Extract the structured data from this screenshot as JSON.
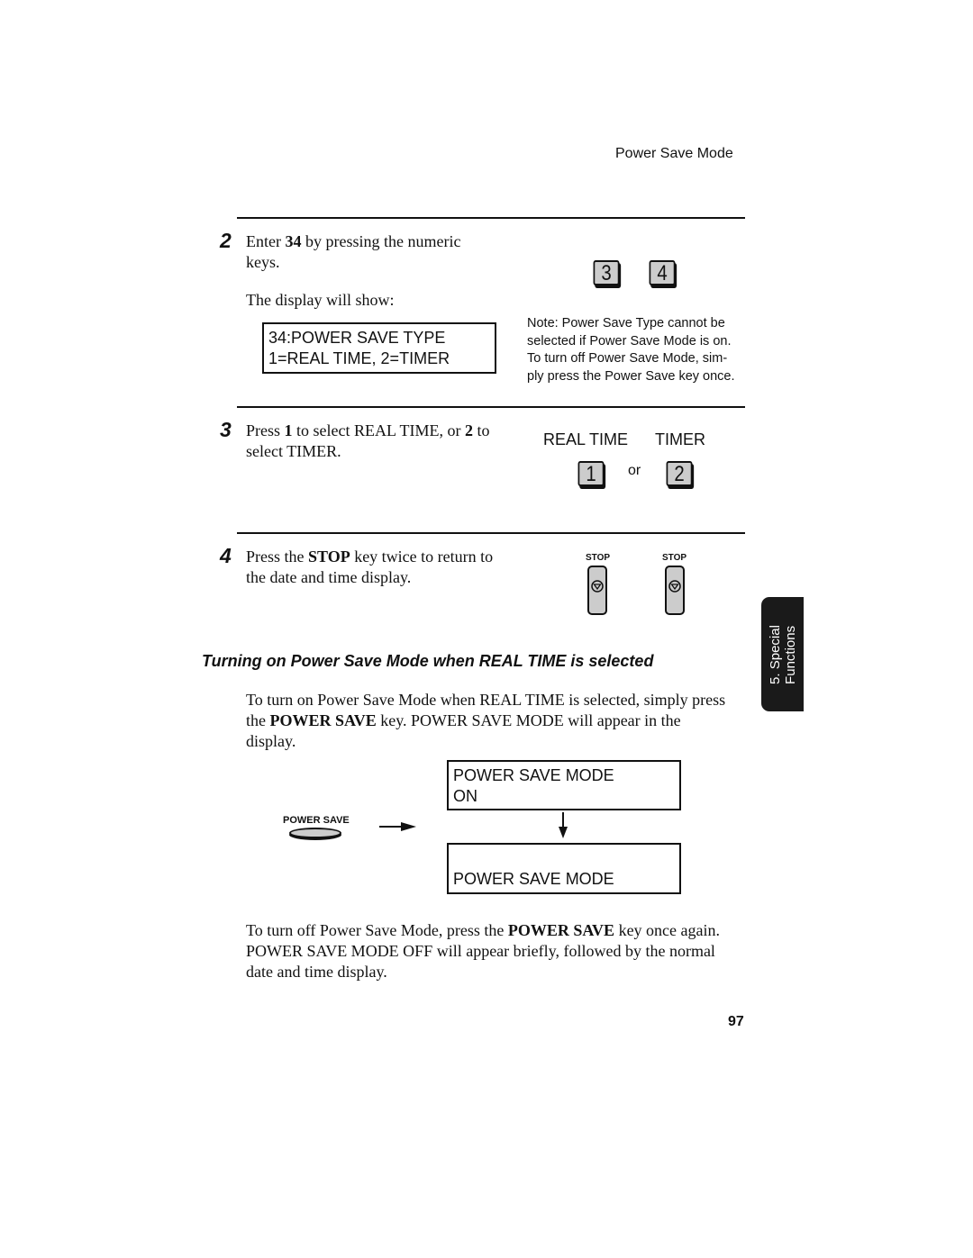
{
  "header": {
    "title": "Power Save Mode"
  },
  "step2": {
    "number": "2",
    "text_parts": [
      "Enter ",
      "34",
      " by pressing the numeric keys."
    ],
    "display_intro": "The display will show:",
    "lcd": [
      "34:POWER SAVE TYPE",
      "1=REAL TIME, 2=TIMER"
    ],
    "keys": [
      "3",
      "4"
    ],
    "note": "Note: Power Save Type cannot be selected if Power Save Mode is on. To turn off Power Save Mode, simply press the Power Save key once.",
    "note_lines": [
      "Note: Power Save Type cannot be",
      "selected if Power Save Mode is on.",
      "To turn off Power Save Mode, sim-",
      "ply press the Power Save key once."
    ]
  },
  "step3": {
    "number": "3",
    "text_parts": [
      "Press ",
      "1",
      " to select REAL TIME, or ",
      "2",
      " to select TIMER."
    ],
    "label_real_time": "REAL TIME",
    "label_timer": "TIMER",
    "keys": [
      "1",
      "2"
    ],
    "or": "or"
  },
  "step4": {
    "number": "4",
    "text_parts": [
      "Press the ",
      "STOP",
      " key twice to return to the date and time display."
    ],
    "stop_label": "STOP"
  },
  "section": {
    "heading": "Turning on Power Save Mode when REAL TIME is selected",
    "para1_parts": [
      "To turn on Power Save Mode when REAL TIME is selected, simply press the ",
      "POWER SAVE",
      " key. POWER SAVE MODE will appear in the display."
    ],
    "power_save_label": "POWER SAVE",
    "lcd1": [
      "POWER SAVE MODE",
      "ON"
    ],
    "lcd2": [
      "",
      "POWER SAVE MODE"
    ],
    "para2_parts": [
      "To turn off Power Save Mode, press the ",
      "POWER SAVE",
      " key once again. POWER SAVE MODE OFF will appear briefly, followed by the normal date and time display."
    ]
  },
  "side_tab": {
    "line1": "5. Special",
    "line2": "Functions"
  },
  "page_number": "97"
}
